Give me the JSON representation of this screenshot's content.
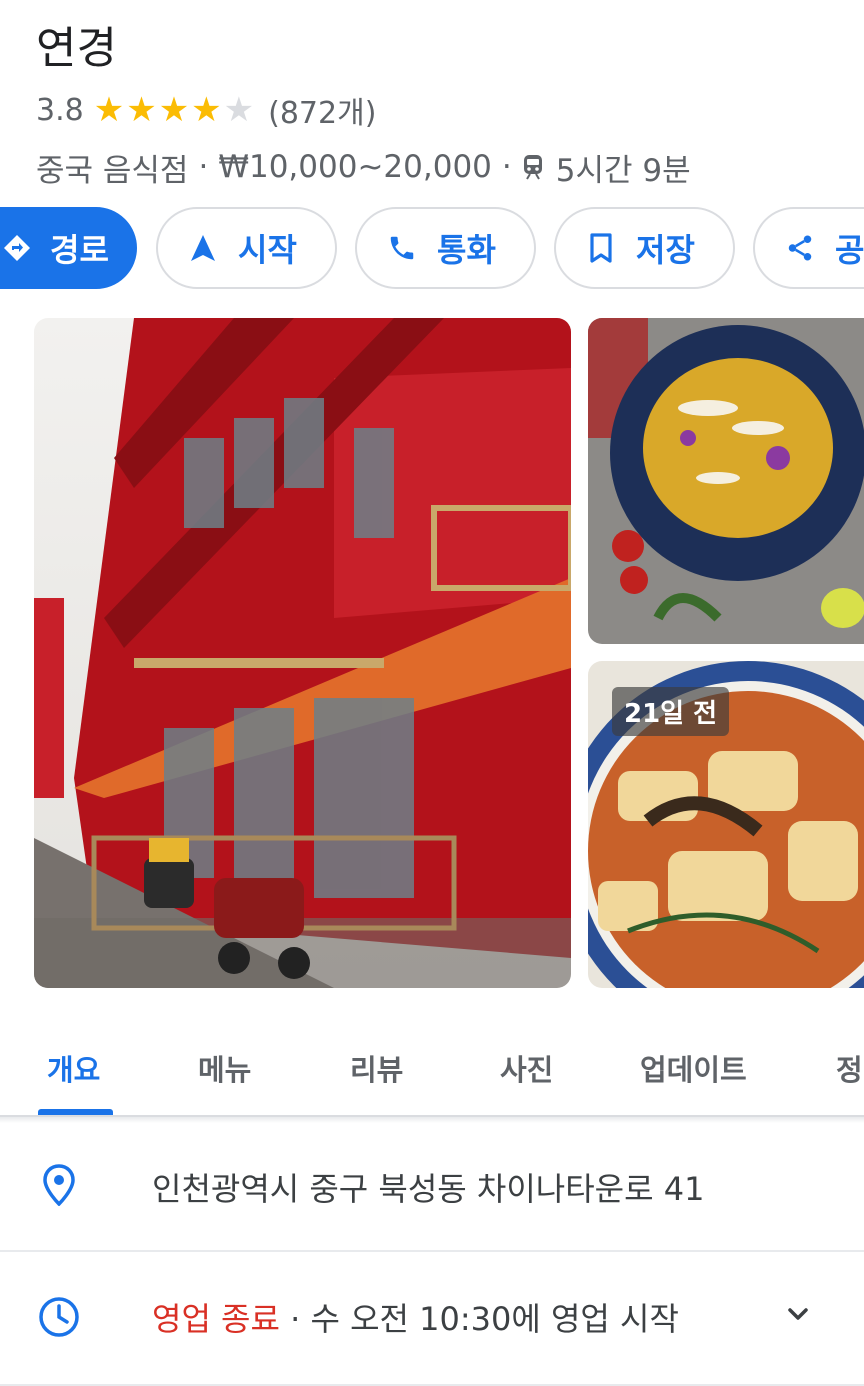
{
  "place": {
    "name": "연경",
    "rating": "3.8",
    "stars_filled": 4,
    "stars_total": 5,
    "review_count": "(872개)",
    "category": "중국 음식점",
    "price_range": "₩10,000~20,000",
    "transit_time": "5시간 9분"
  },
  "actions": [
    {
      "label": "경로",
      "icon": "directions-icon"
    },
    {
      "label": "시작",
      "icon": "navigation-arrow-icon"
    },
    {
      "label": "통화",
      "icon": "phone-icon"
    },
    {
      "label": "저장",
      "icon": "bookmark-icon"
    },
    {
      "label": "공",
      "icon": "share-icon"
    }
  ],
  "photos": {
    "badge": "21일 전"
  },
  "tabs": [
    {
      "label": "개요",
      "active": true
    },
    {
      "label": "메뉴"
    },
    {
      "label": "리뷰"
    },
    {
      "label": "사진"
    },
    {
      "label": "업데이트"
    },
    {
      "label": "정"
    }
  ],
  "address": "인천광역시 중구 북성동 차이나타운로 41",
  "hours": {
    "status": "영업 종료",
    "detail": "· 수 오전 10:30에 영업 시작"
  },
  "colors": {
    "accent": "#1a73e8",
    "star": "#fbbc04",
    "closed": "#d93025"
  }
}
